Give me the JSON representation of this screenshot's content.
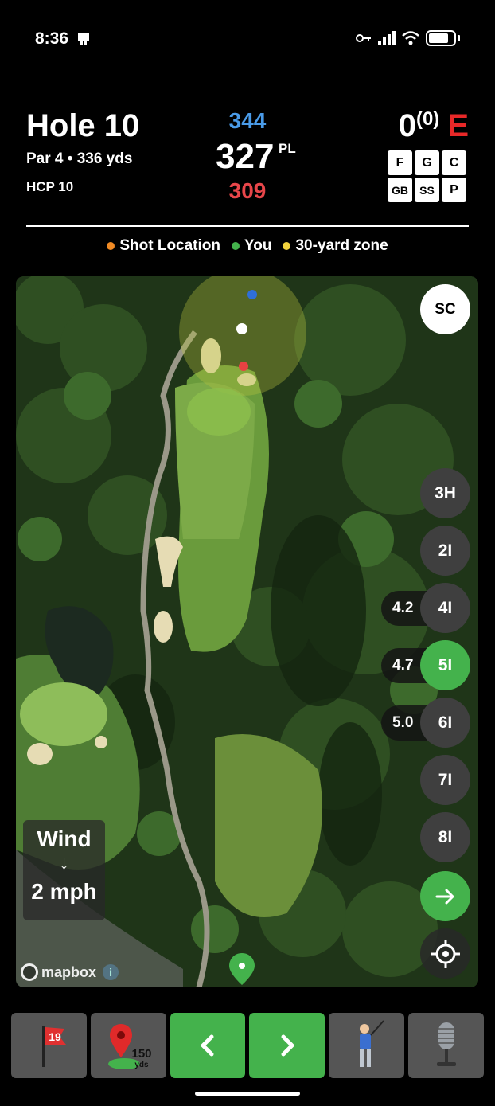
{
  "status": {
    "time": "8:36"
  },
  "hole": {
    "title": "Hole 10",
    "par_yards": "Par 4  •  336 yds",
    "hcp": "HCP 10"
  },
  "distances": {
    "back": "344",
    "middle": "327",
    "middle_label": "PL",
    "front": "309"
  },
  "score": {
    "total": "0",
    "paren": "(0)",
    "relative": "E",
    "stats": [
      "F",
      "G",
      "C",
      "GB",
      "SS",
      "P"
    ]
  },
  "legend": [
    {
      "label": "Shot Location",
      "color": "#f08a24"
    },
    {
      "label": "You",
      "color": "#44b24c"
    },
    {
      "label": "30-yard zone",
      "color": "#f2d23c"
    }
  ],
  "map": {
    "sc_label": "SC",
    "clubs": [
      {
        "label": "3H",
        "active": false,
        "value": ""
      },
      {
        "label": "2I",
        "active": false,
        "value": ""
      },
      {
        "label": "4I",
        "active": false,
        "value": "4.2"
      },
      {
        "label": "5I",
        "active": true,
        "value": "4.7"
      },
      {
        "label": "6I",
        "active": false,
        "value": "5.0"
      },
      {
        "label": "7I",
        "active": false,
        "value": ""
      },
      {
        "label": "8I",
        "active": false,
        "value": ""
      }
    ],
    "wind": {
      "title": "Wind",
      "arrow": "↓",
      "speed": "2 mph"
    },
    "attribution": "mapbox"
  },
  "toolbar": {
    "flag_number": "19",
    "yardage_marker": "150",
    "yardage_unit": "yds"
  },
  "colors": {
    "accent_green": "#44b24c",
    "back_blue": "#4a9be8",
    "front_red": "#e8464a",
    "score_red": "#e82828"
  }
}
